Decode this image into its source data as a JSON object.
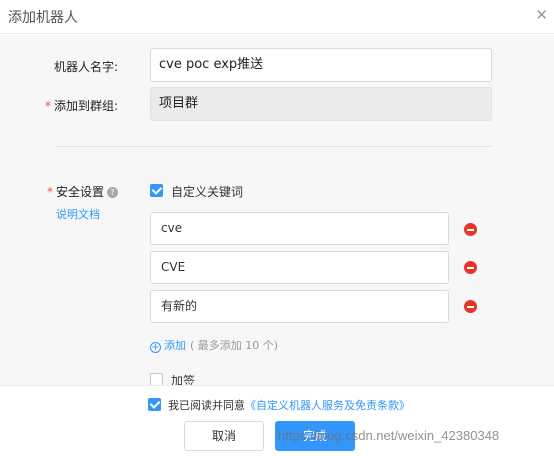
{
  "dialog": {
    "title": "添加机器人"
  },
  "form": {
    "name_label": "机器人名字:",
    "name_value": "cve  poc  exp推送",
    "group_label": "添加到群组:",
    "group_value": "项目群",
    "security_label": "安全设置",
    "doc_link": "说明文档",
    "custom_keyword_label": "自定义关键词",
    "keywords": [
      "cve",
      "CVE",
      "有新的"
    ],
    "add_label": "添加",
    "add_hint": "( 最多添加 10 个)",
    "sign_label": "加签"
  },
  "footer": {
    "agree_text": "我已阅读并同意",
    "agree_link": "《自定义机器人服务及免责条款》",
    "cancel_label": "取消",
    "done_label": "完成"
  },
  "watermark": "https://blog.csdn.net/weixin_42380348",
  "colors": {
    "accent": "#3296fa",
    "danger": "#e8332a",
    "required": "#f25643"
  }
}
